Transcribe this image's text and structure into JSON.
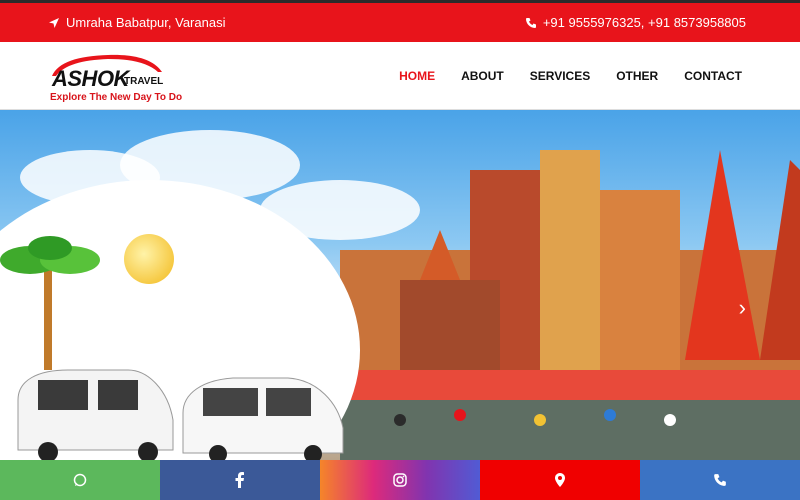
{
  "topbar": {
    "location": "Umraha Babatpur, Varanasi",
    "phones": "+91 9555976325,  +91 8573958805"
  },
  "logo": {
    "brand": "ASHOK",
    "brand_suffix": "TRAVEL",
    "tagline": "Explore The New Day To Do"
  },
  "nav": {
    "items": [
      {
        "label": "HOME",
        "active": true
      },
      {
        "label": "ABOUT",
        "active": false
      },
      {
        "label": "SERVICES",
        "active": false
      },
      {
        "label": "OTHER",
        "active": false
      },
      {
        "label": "CONTACT",
        "active": false
      }
    ]
  },
  "colors": {
    "brand_red": "#e8141b",
    "whatsapp": "#5cb85c",
    "facebook": "#3b5998",
    "instagram": "#d6249f",
    "location": "#f00000",
    "phone": "#3b73c4"
  },
  "social": [
    {
      "icon": "whatsapp-icon"
    },
    {
      "icon": "facebook-icon"
    },
    {
      "icon": "instagram-icon"
    },
    {
      "icon": "map-pin-icon"
    },
    {
      "icon": "phone-icon"
    }
  ]
}
